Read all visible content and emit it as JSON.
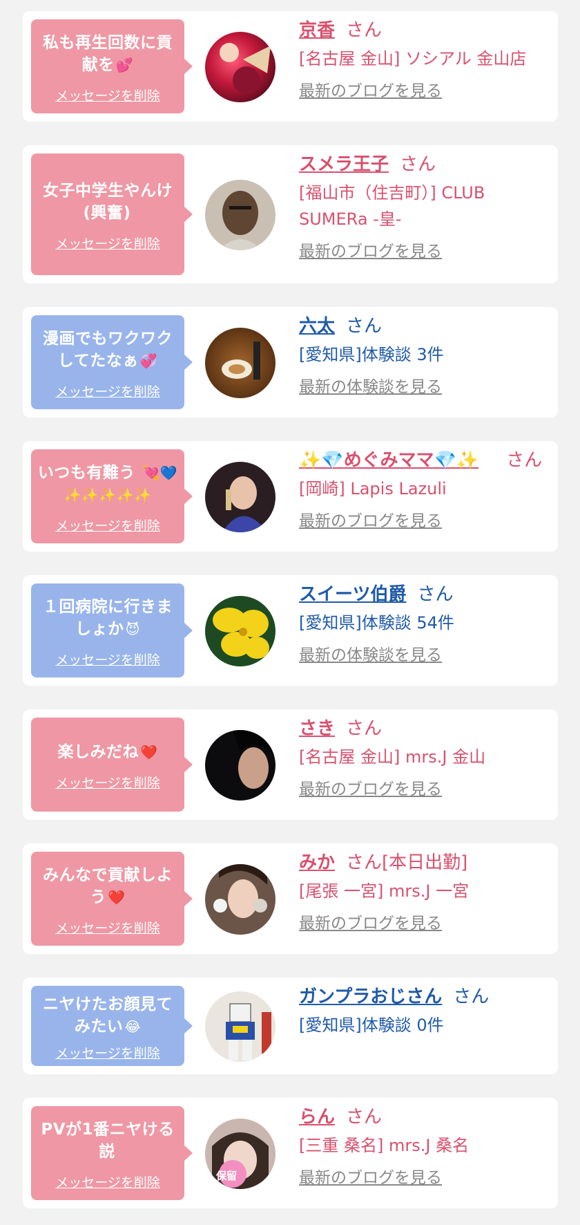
{
  "delete_label": "メッセージを削除",
  "cards": [
    {
      "message": "私も再生回数に貢献を",
      "message_emoji": "💕",
      "name": "京香",
      "honorific": "さん",
      "shop": "[名古屋 金山] ソシアル 金山店",
      "link": "最新のブログを見る"
    },
    {
      "message": "女子中学生やんけ(興奮)",
      "message_emoji": "",
      "name": "スメラ王子",
      "honorific": "さん",
      "shop": "[福山市（住吉町）] CLUB SUMERa -皇-",
      "link": "最新のブログを見る"
    },
    {
      "message": "漫画でもワクワクしてたなぁ",
      "message_emoji": "💞",
      "name": "六太",
      "honorific": "さん",
      "shop": "[愛知県]体験談 3件",
      "link": "最新の体験談を見る"
    },
    {
      "message": "いつも有難う",
      "message_emoji": "💘💙✨✨✨✨✨",
      "name": "めぐみママ",
      "name_prefix": "✨💎",
      "name_suffix": "💎✨",
      "honorific": "さん",
      "shop": "[岡崎] Lapis Lazuli",
      "link": "最新のブログを見る"
    },
    {
      "message": "１回病院に行きましょか",
      "message_emoji": "😈",
      "name": "スイーツ伯爵",
      "honorific": "さん",
      "shop": "[愛知県]体験談 54件",
      "link": "最新の体験談を見る"
    },
    {
      "message": "楽しみだね",
      "message_emoji": "❤️",
      "name": "さき",
      "honorific": "さん",
      "shop": "[名古屋 金山] mrs.J 金山",
      "link": "最新のブログを見る"
    },
    {
      "message": "みんなで貢献しよう",
      "message_emoji": "❤️",
      "name": "みか",
      "honorific": "さん[本日出勤]",
      "shop": "[尾張 一宮] mrs.J 一宮",
      "link": "最新のブログを見る"
    },
    {
      "message": "ニヤけたお顔見てみたい",
      "message_emoji": "😂",
      "name": "ガンプラおじさん",
      "honorific": "さん",
      "shop": "[愛知県]体験談 0件",
      "link": ""
    },
    {
      "message": "PVが1番ニヤける説",
      "message_emoji": "",
      "name": "らん",
      "honorific": "さん",
      "shop": "[三重 桑名] mrs.J 桑名",
      "link": "最新のブログを見る",
      "avatar_stamp": "保留"
    }
  ]
}
